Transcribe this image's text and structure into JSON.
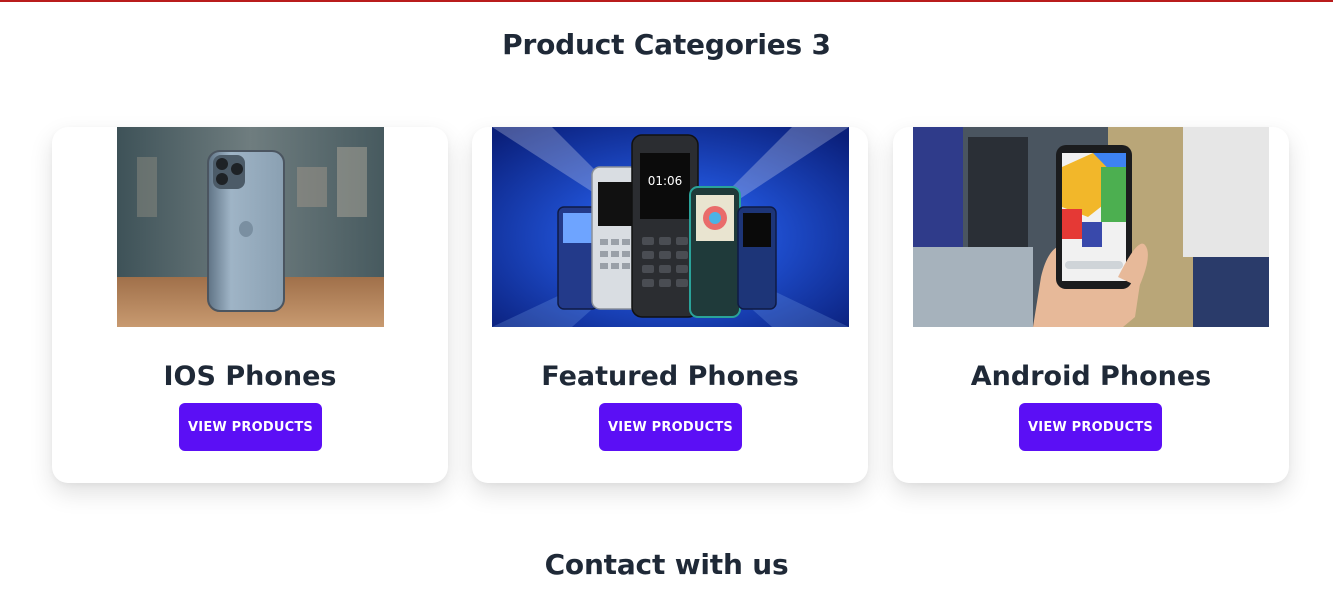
{
  "header": {
    "title": "Product Categories 3"
  },
  "categories": [
    {
      "name": "IOS Phones",
      "button_label": "VIEW PRODUCTS",
      "image": "iphone-photo"
    },
    {
      "name": "Featured Phones",
      "button_label": "VIEW PRODUCTS",
      "image": "feature-phones-photo"
    },
    {
      "name": "Android Phones",
      "button_label": "VIEW PRODUCTS",
      "image": "android-phone-photo"
    }
  ],
  "footer": {
    "title": "Contact with us"
  },
  "colors": {
    "accent": "#5b0ff5",
    "heading": "#1f2937",
    "top_rule": "#b91c1c"
  }
}
